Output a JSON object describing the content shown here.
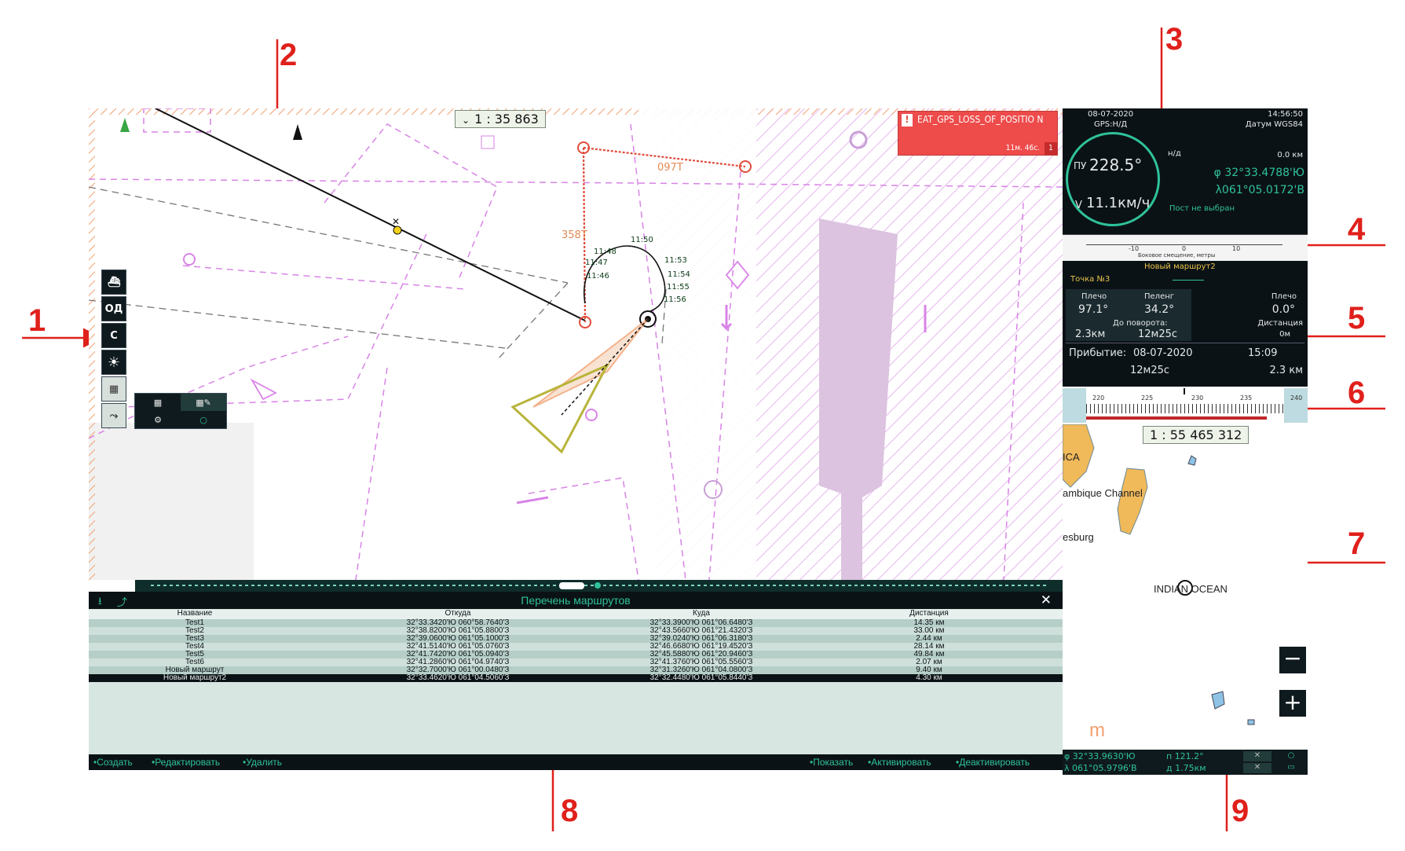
{
  "callouts": [
    "1",
    "2",
    "3",
    "4",
    "5",
    "6",
    "7",
    "8",
    "9"
  ],
  "chart": {
    "scale": "1 :  35 863",
    "scale_chevron": "⌄",
    "alarm": {
      "icon": "!",
      "text": "EAT_GPS_LOSS_OF_POSITIO N",
      "time": "11м. 46с.",
      "count": "1"
    },
    "course_labels": {
      "c1": "358T",
      "c2": "097T"
    },
    "time_ticks": [
      "11:48",
      "11:47",
      "11:46",
      "11:50",
      "11:53",
      "11:54",
      "11:55",
      "11:56"
    ],
    "left_toolbar": [
      "ОД",
      "С"
    ],
    "colors": {
      "chart_bg": "#ffffff",
      "route_red": "#e04a3a",
      "magenta": "#d884e6",
      "land_purple": "#dcc3e0"
    }
  },
  "nav": {
    "date": "08-07-2020",
    "time": "14:56:50",
    "gps": "GPS:Н/Д",
    "datum": "Датум WGS84",
    "course": "228.5°",
    "course_label": "ПУ",
    "speed": "11.1км/ч",
    "speed_label": "V",
    "nd": "н/д",
    "dist": "0.0 км",
    "lat": "φ 32°33.4788'Ю",
    "lon": "λ061°05.0172'В",
    "post": "Пост не выбран"
  },
  "xtrack": {
    "ticks": [
      "-10",
      "0",
      "10"
    ],
    "caption": "Боковое смещение, метры"
  },
  "route": {
    "name": "Новый маршрут2",
    "point": "Точка №3",
    "plecho_label": "Плечо",
    "peleng_label": "Пеленг",
    "plecho": "97.1°",
    "peleng": "34.2°",
    "plecho2_label": "Плечо",
    "plecho2": "0.0°",
    "to_turn_label": "До поворота:",
    "to_turn_dist": "2.3км",
    "to_turn_time": "12м25с",
    "dist_label": "Дистанция",
    "dist_value": "0м",
    "arrival_label": "Прибытие:",
    "arrival_date": "08-07-2020",
    "arrival_time": "15:09",
    "remain_time": "12м25с",
    "remain_dist": "2.3 км"
  },
  "compass_tape": [
    "220",
    "225",
    "230",
    "235",
    "240"
  ],
  "overview": {
    "scale": "1 : 55 465 312",
    "labels": [
      "ICA",
      "ambique Channel",
      "esburg",
      "INDIAN OCEAN"
    ],
    "zoom_out": "−",
    "zoom_in": "+",
    "logo": "m"
  },
  "status": {
    "lat": "φ  32°33.9630'Ю",
    "lon": "λ 061°05.9796'В",
    "bearing": "п 121.2°",
    "distance": "д 1.75км"
  },
  "routes": {
    "title": "Перечень маршрутов",
    "close": "✕",
    "columns": [
      "Название",
      "Откуда",
      "Куда",
      "Дистанция"
    ],
    "rows": [
      [
        "Test1",
        "32°33.3420'Ю 060°58.7640'З",
        "32°33.3900'Ю 061°06.6480'З",
        "14.35 км"
      ],
      [
        "Test2",
        "32°38.8200'Ю 061°05.8800'З",
        "32°43.5660'Ю 061°21.4320'З",
        "33.00 км"
      ],
      [
        "Test3",
        "32°39.0600'Ю 061°05.1000'З",
        "32°39.0240'Ю 061°06.3180'З",
        "2.44 км"
      ],
      [
        "Test4",
        "32°41.5140'Ю 061°05.0760'З",
        "32°46.6680'Ю 061°19.4520'З",
        "28.14 км"
      ],
      [
        "Test5",
        "32°41.7420'Ю 061°05.0940'З",
        "32°45.5880'Ю 061°20.9460'З",
        "49.84 км"
      ],
      [
        "Test6",
        "32°41.2860'Ю 061°04.9740'З",
        "32°41.3760'Ю 061°05.5560'З",
        "2.07 км"
      ],
      [
        "Новый маршрут",
        "32°32.7000'Ю 061°00.0480'З",
        "32°31.3260'Ю 061°04.0800'З",
        "9.40 км"
      ],
      [
        "Новый маршрут2",
        "32°33.4620'Ю 061°04.5060'З",
        "32°32.4480'Ю 061°05.8440'З",
        "4.30 км"
      ]
    ],
    "actions_left": [
      "•Создать",
      "•Редактировать",
      "•Удалить"
    ],
    "actions_right": [
      "•Показать",
      "•Активировать",
      "•Деактивировать"
    ]
  }
}
